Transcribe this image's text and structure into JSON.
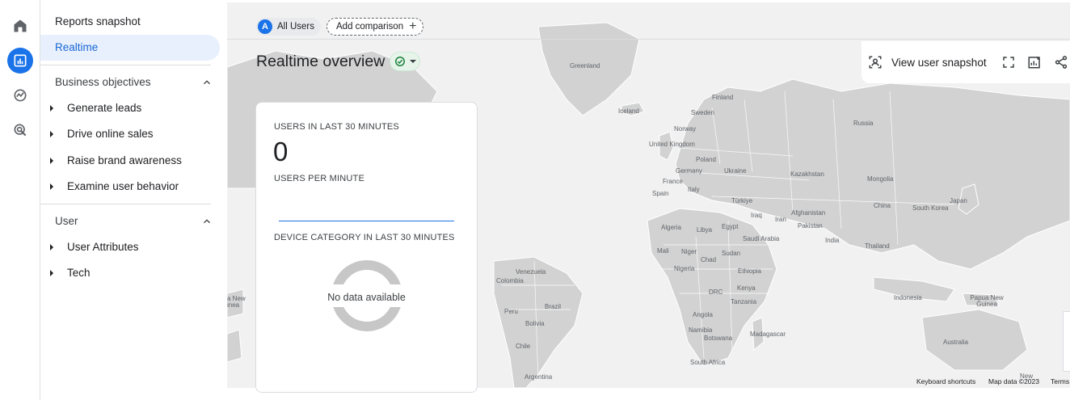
{
  "nav": {
    "reports_snapshot": "Reports snapshot",
    "realtime": "Realtime",
    "sections": [
      {
        "title": "Business objectives",
        "items": [
          "Generate leads",
          "Drive online sales",
          "Raise brand awareness",
          "Examine user behavior"
        ]
      },
      {
        "title": "User",
        "items": [
          "User Attributes",
          "Tech"
        ]
      }
    ]
  },
  "comparison": {
    "segment_letter": "A",
    "segment_label": "All Users",
    "add_label": "Add comparison"
  },
  "page": {
    "title": "Realtime overview"
  },
  "toolbar": {
    "snapshot_label": "View user snapshot"
  },
  "card": {
    "users_label": "USERS IN LAST 30 MINUTES",
    "users_value": "0",
    "per_minute_label": "USERS PER MINUTE",
    "device_label": "DEVICE CATEGORY IN LAST 30 MINUTES",
    "no_data": "No data available"
  },
  "map": {
    "labels": [
      "Greenland",
      "Iceland",
      "Finland",
      "Sweden",
      "Norway",
      "Russia",
      "United Kingdom",
      "Poland",
      "Germany",
      "Ukraine",
      "France",
      "Italy",
      "Spain",
      "Kazakhstan",
      "Mongolia",
      "Türkiye",
      "China",
      "South Korea",
      "Japan",
      "Afghanistan",
      "Iraq",
      "Iran",
      "Pakistan",
      "Algeria",
      "Libya",
      "Egypt",
      "Saudi Arabia",
      "India",
      "Thailand",
      "Mali",
      "Niger",
      "Chad",
      "Sudan",
      "Nigeria",
      "Ethiopia",
      "Venezuela",
      "Colombia",
      "DRC",
      "Kenya",
      "Tanzania",
      "Indonesia",
      "Papua New Guinea",
      "Peru",
      "Brazil",
      "Bolivia",
      "Angola",
      "Namibia",
      "Botswana",
      "Madagascar",
      "Chile",
      "South Africa",
      "Australia",
      "Argentina",
      "a New",
      "inea",
      "New"
    ],
    "footer": [
      "Keyboard shortcuts",
      "Map data ©2023",
      "Terms"
    ]
  },
  "colors": {
    "accent": "#1a73e8",
    "nav_active_bg": "#e8f0fe",
    "map_bg": "#f1f1f1",
    "land": "#d2d2d2",
    "status_ok": "#188038"
  }
}
